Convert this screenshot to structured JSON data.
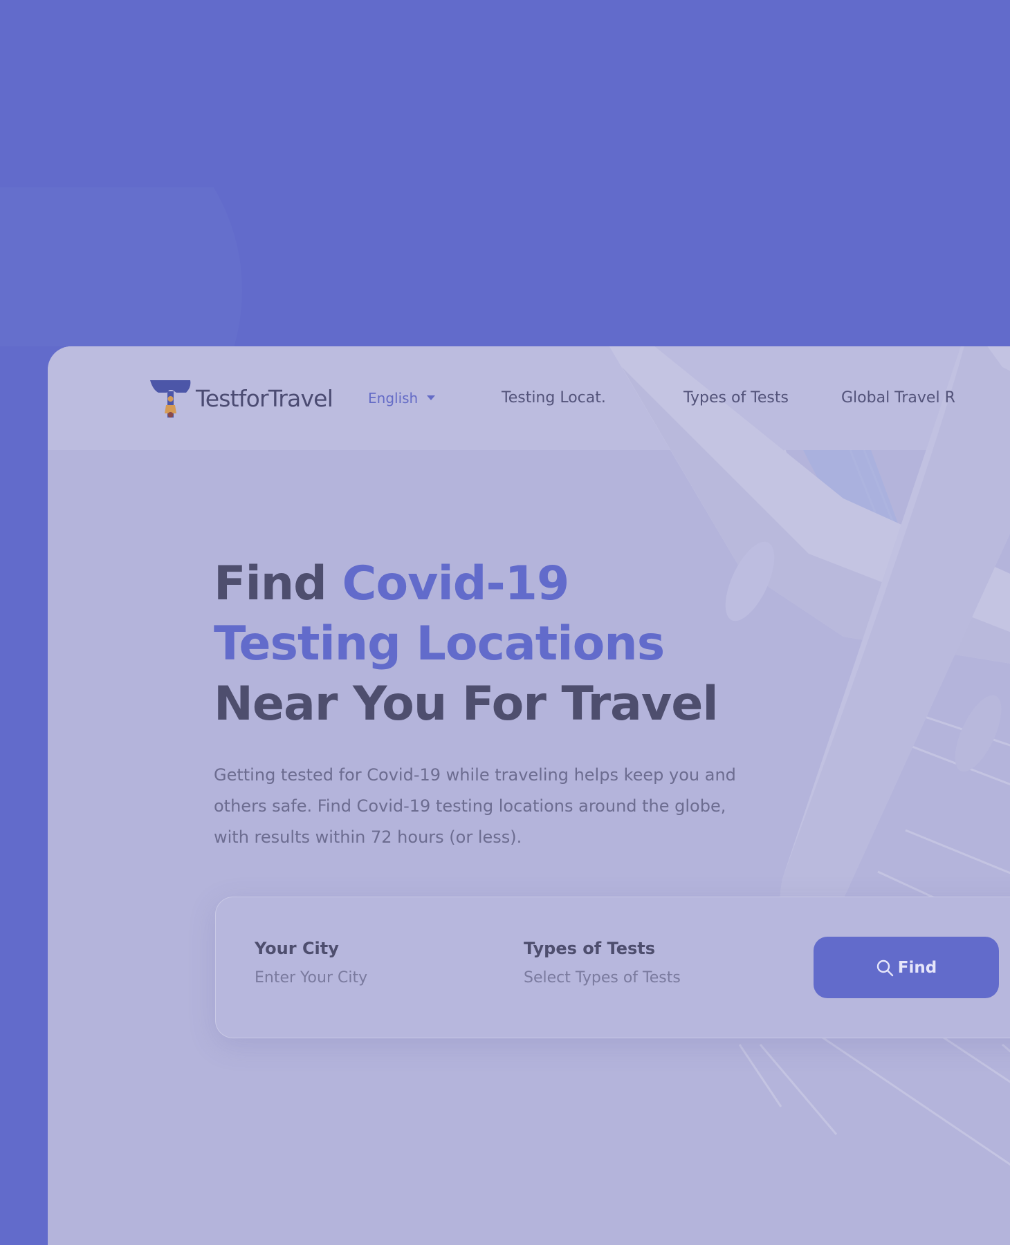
{
  "brand": {
    "name": "TestforTravel",
    "logo_icon": "t-logo-with-person-icon"
  },
  "language": {
    "selected": "English",
    "caret_icon": "caret-down-icon"
  },
  "nav": {
    "items": [
      {
        "label": "Testing Locat."
      },
      {
        "label": "Types of Tests"
      },
      {
        "label": "Global Travel R"
      }
    ]
  },
  "hero": {
    "title_part1": "Find ",
    "title_accent1": "Covid-19",
    "title_accent2": "Testing Locations",
    "title_part3": "Near You For Travel",
    "description": "Getting tested for Covid-19 while traveling helps keep you and others safe. Find Covid-19 testing locations around the globe, with results within 72 hours (or less)."
  },
  "search": {
    "city_label": "Your City",
    "city_placeholder": "Enter Your City",
    "tests_label": "Types of Tests",
    "tests_placeholder": "Select Types of Tests",
    "find_label": "Find",
    "find_icon": "search-icon"
  },
  "colors": {
    "background": "#626bcb",
    "accent": "#626bcb",
    "card": "#b4b4db",
    "heading": "#4e4e6e"
  }
}
